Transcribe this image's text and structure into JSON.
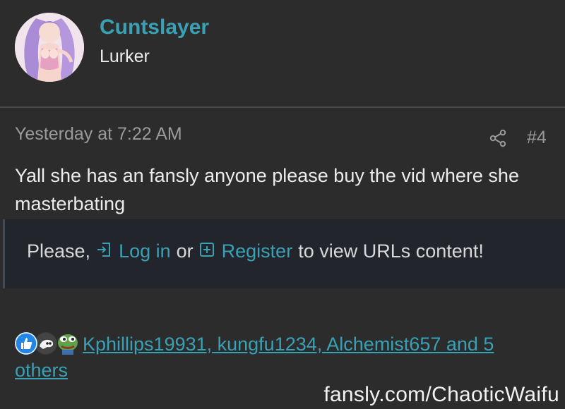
{
  "user": {
    "name": "Cuntslayer",
    "title": "Lurker"
  },
  "post": {
    "timestamp": "Yesterday at 7:22 AM",
    "number": "#4",
    "body": "Yall she has an fansly anyone please buy the vid where she masterbating"
  },
  "notice": {
    "prefix": "Please,",
    "login_label": "Log in",
    "or_text": "or",
    "register_label": "Register",
    "suffix": "to view URLs content!"
  },
  "reactions": {
    "line1": "Kphillips19931, kungfu1234, Alchemist657 and 5",
    "line2": "others",
    "icons": [
      "like-icon",
      "skull-icon",
      "pepe-icon"
    ]
  },
  "watermark": "fansly.com/ChaoticWaifu",
  "colors": {
    "background": "#2c2c2c",
    "accent": "#3aa0b3",
    "muted": "#9a9a9a",
    "notice_bg": "#22252c"
  }
}
